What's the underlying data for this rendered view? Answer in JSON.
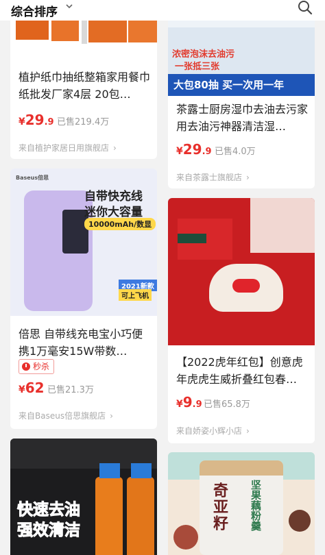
{
  "header": {
    "sort_label": "综合排序"
  },
  "products": [
    {
      "title": "植护纸巾抽纸整箱家用餐巾纸批发厂家4层 20包…",
      "price_int": "29",
      "price_dec": ".9",
      "sold": "已售219.4万",
      "store": "来自植护家居日用旗舰店"
    },
    {
      "banner_top": "浓密泡沫去油污",
      "banner_sub": "一张抵三张",
      "banner_main": "大包80抽  买一次用一年",
      "title": "茶露士厨房湿巾去油去污家用去油污神器清洁湿…",
      "price_int": "29",
      "price_dec": ".9",
      "sold": "已售4.0万",
      "store": "来自茶露士旗舰店"
    },
    {
      "brand": "Baseus倍思",
      "headline1": "自带快充线",
      "headline2": "迷你大容量",
      "capacity": "10000mAh/数显",
      "badge1": "2021新款",
      "badge2": "可上飞机",
      "title": "倍思 自带线充电宝小巧便携1万毫安15W带数…",
      "flash": "秒杀",
      "price_int": "62",
      "price_dec": "",
      "sold": "已售21.3万",
      "store": "来自Baseus倍思旗舰店"
    },
    {
      "title": "【2022虎年红包】创意虎年虎虎生威折叠红包春…",
      "price_int": "9",
      "price_dec": ".9",
      "sold": "已售65.8万",
      "store": "来自娇姿小辉小店"
    },
    {
      "line1": "快速去油",
      "line2": "强效清洁"
    },
    {
      "jar_brand": "奇亚籽",
      "jar_label": "坚果藕粉羹"
    }
  ]
}
